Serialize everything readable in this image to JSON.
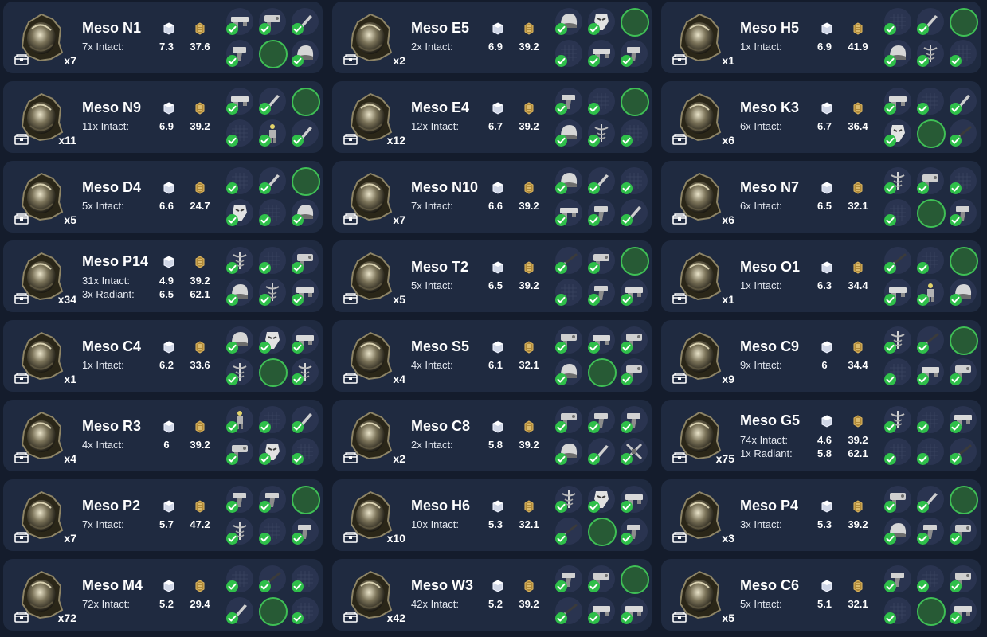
{
  "colors": {
    "background": "#141c2c",
    "card": "#1f2a40",
    "owned_green": "#2fbf4a",
    "empty_slot_green": "#3fbf55"
  },
  "icons": {
    "relic": "meso-relic-icon",
    "inventory": "chest-icon",
    "platinum": "platinum-icon",
    "ducats": "ducat-icon",
    "owned": "checkmark-icon"
  },
  "relics": [
    {
      "name": "Meso N1",
      "count": "x7",
      "rows": [
        {
          "label": "7x Intact:",
          "plat": "7.3",
          "ducats": "37.6"
        }
      ],
      "slots": [
        "rifle",
        "gun",
        "blade",
        "pistol",
        "empty",
        "helmet"
      ]
    },
    {
      "name": "Meso E5",
      "count": "x2",
      "rows": [
        {
          "label": "2x Intact:",
          "plat": "6.9",
          "ducats": "39.2"
        }
      ],
      "slots": [
        "helmet",
        "mask",
        "empty",
        "blank",
        "rifle",
        "pistol"
      ]
    },
    {
      "name": "Meso H5",
      "count": "x1",
      "rows": [
        {
          "label": "1x Intact:",
          "plat": "6.9",
          "ducats": "41.9"
        }
      ],
      "slots": [
        "blank",
        "blade",
        "empty",
        "helmet",
        "caduceus",
        "blank"
      ]
    },
    {
      "name": "Meso N9",
      "count": "x11",
      "rows": [
        {
          "label": "11x Intact:",
          "plat": "6.9",
          "ducats": "39.2"
        }
      ],
      "slots": [
        "rifle",
        "blade",
        "empty",
        "blank",
        "figure",
        "blade"
      ]
    },
    {
      "name": "Meso E4",
      "count": "x12",
      "rows": [
        {
          "label": "12x Intact:",
          "plat": "6.7",
          "ducats": "39.2"
        }
      ],
      "slots": [
        "pistol",
        "blank",
        "empty",
        "helmet",
        "caduceus",
        "blank"
      ]
    },
    {
      "name": "Meso K3",
      "count": "x6",
      "rows": [
        {
          "label": "6x Intact:",
          "plat": "6.7",
          "ducats": "36.4"
        }
      ],
      "slots": [
        "rifle",
        "blank",
        "blade",
        "mask",
        "empty",
        "whip"
      ]
    },
    {
      "name": "Meso D4",
      "count": "x5",
      "rows": [
        {
          "label": "5x Intact:",
          "plat": "6.6",
          "ducats": "24.7"
        }
      ],
      "slots": [
        "blank",
        "blade",
        "empty",
        "mask",
        "blank",
        "helmet"
      ]
    },
    {
      "name": "Meso N10",
      "count": "x7",
      "rows": [
        {
          "label": "7x Intact:",
          "plat": "6.6",
          "ducats": "39.2"
        }
      ],
      "slots": [
        "helmet",
        "blade",
        "blank",
        "rifle",
        "pistol",
        "blade"
      ]
    },
    {
      "name": "Meso N7",
      "count": "x6",
      "rows": [
        {
          "label": "6x Intact:",
          "plat": "6.5",
          "ducats": "32.1"
        }
      ],
      "slots": [
        "caduceus",
        "gun",
        "blank",
        "blank",
        "empty",
        "pistol"
      ]
    },
    {
      "name": "Meso P14",
      "count": "x34",
      "rows": [
        {
          "label": "31x Intact:",
          "plat": "4.9",
          "ducats": "39.2"
        },
        {
          "label": "3x Radiant:",
          "plat": "6.5",
          "ducats": "62.1"
        }
      ],
      "slots": [
        "caduceus",
        "blank",
        "gun",
        "helmet",
        "caduceus",
        "rifle"
      ]
    },
    {
      "name": "Meso T2",
      "count": "x5",
      "rows": [
        {
          "label": "5x Intact:",
          "plat": "6.5",
          "ducats": "39.2"
        }
      ],
      "slots": [
        "whip",
        "gun",
        "empty",
        "blank",
        "pistol",
        "rifle"
      ]
    },
    {
      "name": "Meso O1",
      "count": "x1",
      "rows": [
        {
          "label": "1x Intact:",
          "plat": "6.3",
          "ducats": "34.4"
        }
      ],
      "slots": [
        "whip",
        "blank",
        "empty",
        "rifle",
        "figure",
        "helmet"
      ]
    },
    {
      "name": "Meso C4",
      "count": "x1",
      "rows": [
        {
          "label": "1x Intact:",
          "plat": "6.2",
          "ducats": "33.6"
        }
      ],
      "slots": [
        "helmet",
        "mask",
        "rifle",
        "caduceus",
        "empty",
        "caduceus"
      ]
    },
    {
      "name": "Meso S5",
      "count": "x4",
      "rows": [
        {
          "label": "4x Intact:",
          "plat": "6.1",
          "ducats": "32.1"
        }
      ],
      "slots": [
        "gun",
        "rifle",
        "gun",
        "helmet",
        "empty",
        "gun"
      ]
    },
    {
      "name": "Meso C9",
      "count": "x9",
      "rows": [
        {
          "label": "9x Intact:",
          "plat": "6",
          "ducats": "34.4"
        }
      ],
      "slots": [
        "caduceus",
        "whip",
        "empty",
        "blank",
        "rifle",
        "gun"
      ]
    },
    {
      "name": "Meso R3",
      "count": "x4",
      "rows": [
        {
          "label": "4x Intact:",
          "plat": "6",
          "ducats": "39.2"
        }
      ],
      "slots": [
        "figure",
        "blank",
        "blade",
        "gun",
        "mask",
        "blank"
      ]
    },
    {
      "name": "Meso C8",
      "count": "x2",
      "rows": [
        {
          "label": "2x Intact:",
          "plat": "5.8",
          "ducats": "39.2"
        }
      ],
      "slots": [
        "gun",
        "pistol",
        "pistol",
        "helmet",
        "blade",
        "cross"
      ]
    },
    {
      "name": "Meso G5",
      "count": "x75",
      "rows": [
        {
          "label": "74x Intact:",
          "plat": "4.6",
          "ducats": "39.2"
        },
        {
          "label": "1x Radiant:",
          "plat": "5.8",
          "ducats": "62.1"
        }
      ],
      "slots": [
        "caduceus",
        "blank",
        "rifle",
        "blank",
        "blank",
        "whip"
      ]
    },
    {
      "name": "Meso P2",
      "count": "x7",
      "rows": [
        {
          "label": "7x Intact:",
          "plat": "5.7",
          "ducats": "47.2"
        }
      ],
      "slots": [
        "pistol",
        "pistol",
        "empty",
        "caduceus",
        "blank",
        "pistol"
      ]
    },
    {
      "name": "Meso H6",
      "count": "x10",
      "rows": [
        {
          "label": "10x Intact:",
          "plat": "5.3",
          "ducats": "32.1"
        }
      ],
      "slots": [
        "caduceus",
        "mask",
        "rifle",
        "whip",
        "empty",
        "pistol"
      ]
    },
    {
      "name": "Meso P4",
      "count": "x3",
      "rows": [
        {
          "label": "3x Intact:",
          "plat": "5.3",
          "ducats": "39.2"
        }
      ],
      "slots": [
        "gun",
        "blade",
        "empty",
        "helmet",
        "pistol",
        "gun"
      ]
    },
    {
      "name": "Meso M4",
      "count": "x72",
      "rows": [
        {
          "label": "72x Intact:",
          "plat": "5.2",
          "ducats": "29.4"
        }
      ],
      "slots": [
        "blank",
        "whip",
        "blank",
        "blade",
        "empty",
        "blank"
      ]
    },
    {
      "name": "Meso W3",
      "count": "x42",
      "rows": [
        {
          "label": "42x Intact:",
          "plat": "5.2",
          "ducats": "39.2"
        }
      ],
      "slots": [
        "pistol",
        "gun",
        "empty",
        "whip",
        "rifle",
        "rifle"
      ]
    },
    {
      "name": "Meso C6",
      "count": "x5",
      "rows": [
        {
          "label": "5x Intact:",
          "plat": "5.1",
          "ducats": "32.1"
        }
      ],
      "slots": [
        "pistol",
        "blank",
        "gun",
        "blank",
        "empty",
        "rifle"
      ]
    }
  ]
}
